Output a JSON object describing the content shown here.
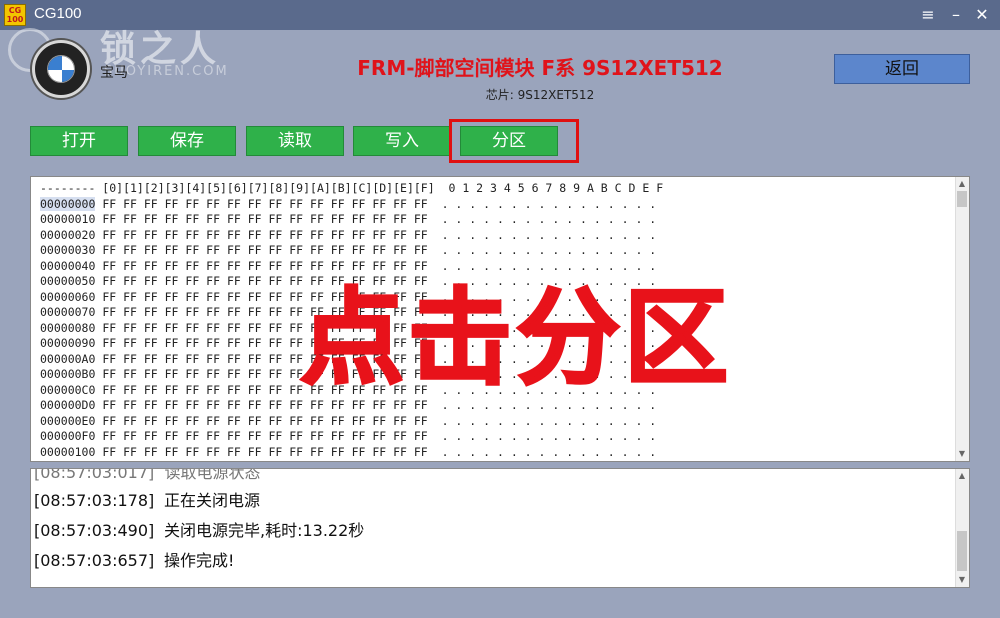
{
  "window": {
    "title": "CG100",
    "icon_text": "CG\n100"
  },
  "watermark": {
    "text": "锁之人",
    "sub": "SUOYIREN.COM"
  },
  "header": {
    "brand": "宝马",
    "module_title": "FRM-脚部空间模块 F系 9S12XET512",
    "chip": "芯片: 9S12XET512",
    "back_label": "返回"
  },
  "toolbar": [
    {
      "label": "打开"
    },
    {
      "label": "保存"
    },
    {
      "label": "读取"
    },
    {
      "label": "写入"
    },
    {
      "label": "分区"
    }
  ],
  "hex": {
    "header_prefix": "--------",
    "columns": [
      "0",
      "1",
      "2",
      "3",
      "4",
      "5",
      "6",
      "7",
      "8",
      "9",
      "A",
      "B",
      "C",
      "D",
      "E",
      "F"
    ],
    "ascii_header": "0 1 2 3 4 5 6 7 8 9 A B C D E F",
    "rows": [
      "00000000",
      "00000010",
      "00000020",
      "00000030",
      "00000040",
      "00000050",
      "00000060",
      "00000070",
      "00000080",
      "00000090",
      "000000A0",
      "000000B0",
      "000000C0",
      "000000D0",
      "000000E0",
      "000000F0",
      "00000100"
    ],
    "byte_value": "FF",
    "ascii_value": "."
  },
  "overlay": "点击分区",
  "log": [
    {
      "time": "[08:57:03:178]",
      "msg": "正在关闭电源"
    },
    {
      "time": "[08:57:03:490]",
      "msg": "关闭电源完毕,耗时:13.22秒"
    },
    {
      "time": "[08:57:03:657]",
      "msg": "操作完成!"
    }
  ],
  "colors": {
    "accent_red": "#e0131a",
    "button_green": "#2fb14a",
    "back_blue": "#5c86cc",
    "window_bg": "#9aa4bc"
  }
}
